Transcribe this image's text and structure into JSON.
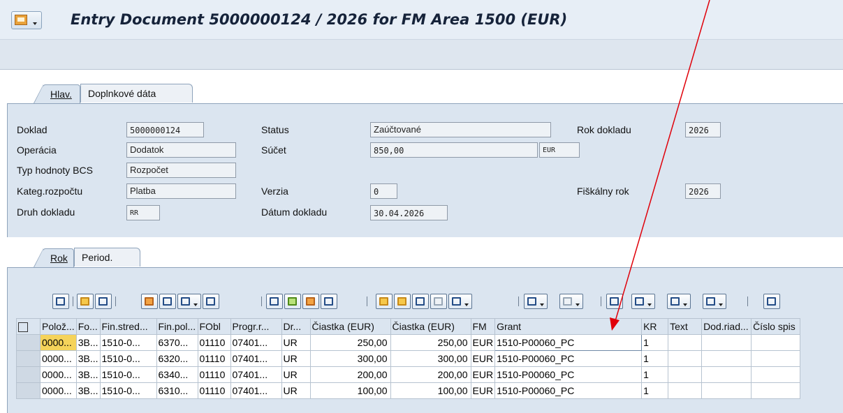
{
  "window": {
    "title": "Entry Document 5000000124 / 2026 for FM Area 1500 (EUR)"
  },
  "header_tabs": [
    {
      "label": "Hlav.",
      "active": true
    },
    {
      "label": "Doplnkové dáta",
      "active": false
    }
  ],
  "header": {
    "doklad": {
      "label": "Doklad",
      "value": "5000000124"
    },
    "operacia": {
      "label": "Operácia",
      "value": "Dodatok"
    },
    "typ_hodnoty": {
      "label": "Typ hodnoty BCS",
      "value": "Rozpočet"
    },
    "kateg": {
      "label": "Kateg.rozpočtu",
      "value": "Platba"
    },
    "druh": {
      "label": "Druh dokladu",
      "value": "RR"
    },
    "status": {
      "label": "Status",
      "value": "Zaúčtované"
    },
    "sucet": {
      "label": "Súčet",
      "value": "850,00",
      "currency": "EUR"
    },
    "verzia": {
      "label": "Verzia",
      "value": "0"
    },
    "datum": {
      "label": "Dátum dokladu",
      "value": "30.04.2026"
    },
    "rok_dokladu": {
      "label": "Rok dokladu",
      "value": "2026"
    },
    "fiskalny_rok": {
      "label": "Fiškálny rok",
      "value": "2026"
    }
  },
  "item_tabs": [
    {
      "label": "Rok",
      "active": true
    },
    {
      "label": "Period.",
      "active": false
    }
  ],
  "grid": {
    "columns": [
      "Polož...",
      "Fo...",
      "Fin.stred...",
      "Fin.pol...",
      "FObl",
      "Progr.r...",
      "Dr...",
      "Čiastka (EUR)",
      "Čiastka (EUR)",
      "FM",
      "Grant",
      "KR",
      "Text",
      "Dod.riad...",
      "Číslo spis"
    ],
    "rows": [
      [
        "0000...",
        "3B...",
        "1510-0...",
        "6370...",
        "01110",
        "07401...",
        "UR",
        "250,00",
        "250,00",
        "EUR",
        "1510-P00060_PC",
        "1",
        "",
        "",
        ""
      ],
      [
        "0000...",
        "3B...",
        "1510-0...",
        "6320...",
        "01110",
        "07401...",
        "UR",
        "300,00",
        "300,00",
        "EUR",
        "1510-P00060_PC",
        "1",
        "",
        "",
        ""
      ],
      [
        "0000...",
        "3B...",
        "1510-0...",
        "6340...",
        "01110",
        "07401...",
        "UR",
        "200,00",
        "200,00",
        "EUR",
        "1510-P00060_PC",
        "1",
        "",
        "",
        ""
      ],
      [
        "0000...",
        "3B...",
        "1510-0...",
        "6310...",
        "01110",
        "07401...",
        "UR",
        "100,00",
        "100,00",
        "EUR",
        "1510-P00060_PC",
        "1",
        "",
        "",
        ""
      ]
    ]
  },
  "icons": {
    "menu": "sap-menu-icon",
    "layout": "table-settings-icon",
    "arrow_color": "#e0000a"
  }
}
